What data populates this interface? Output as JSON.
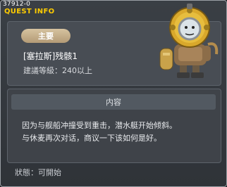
{
  "window": {
    "quest_id": "37912-0",
    "title": "QUEST INFO"
  },
  "quest": {
    "category_badge": "主要",
    "name": "[塞拉斯]残骸1",
    "level_requirement": "建議等級：240以上"
  },
  "content": {
    "header": "内容",
    "lines": [
      "因为与舰船冲撞受到重击，潜水艇开始倾斜。",
      "与休麦再次对话，商议一下该如何是好。"
    ]
  },
  "status": "狀態：可開始",
  "colors": {
    "title": "#ffcc00",
    "badge": "#c9b38f",
    "panel": "#484d54"
  },
  "npc_icon": "diver-helmet-npc"
}
